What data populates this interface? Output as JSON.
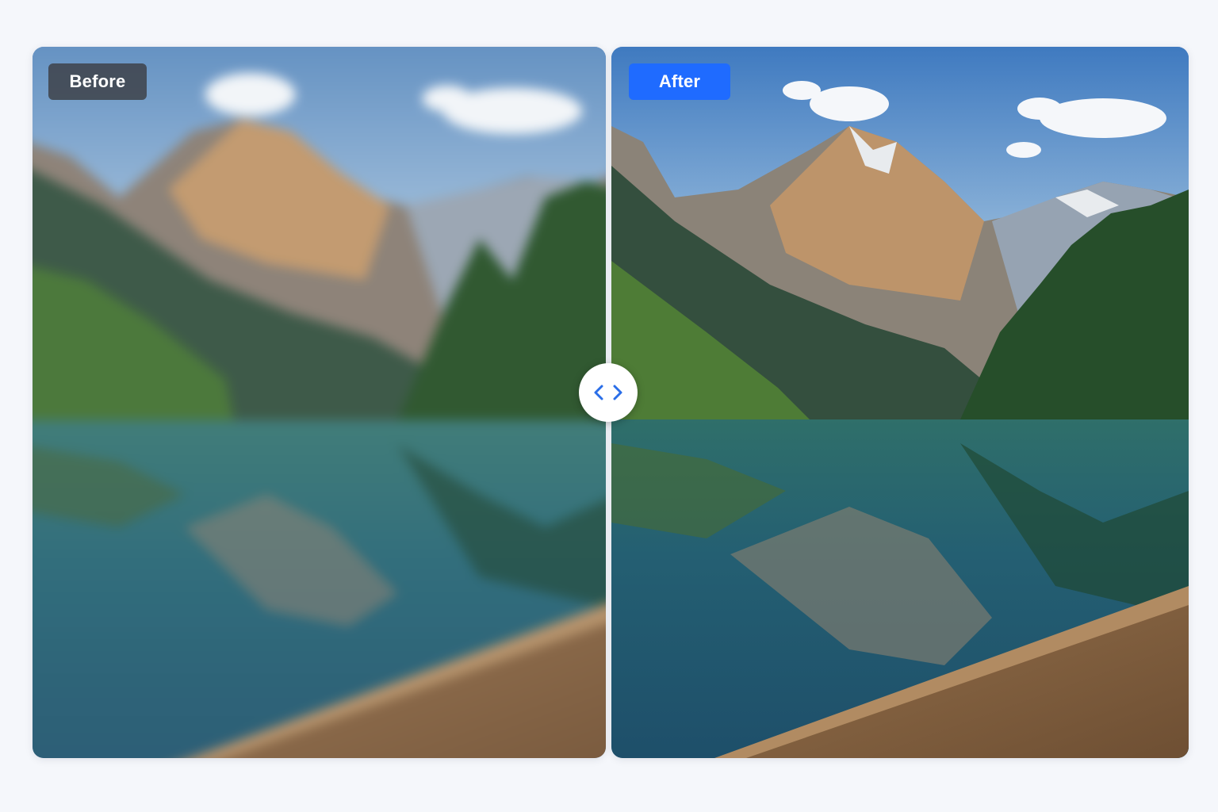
{
  "comparison": {
    "before_label": "Before",
    "after_label": "After"
  },
  "colors": {
    "after_badge": "#1f6bff",
    "before_badge": "#3c3e44",
    "handle_arrows": "#2a6ee8",
    "page_background": "#f5f7fb"
  },
  "icons": {
    "handle": "chevron-left-right-icon"
  }
}
